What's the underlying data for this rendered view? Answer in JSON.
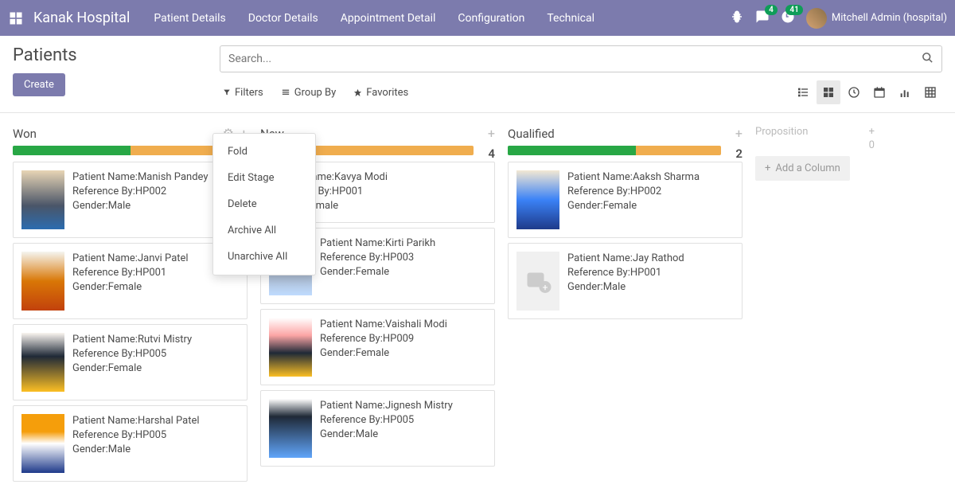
{
  "nav": {
    "brand": "Kanak Hospital",
    "items": [
      "Patient Details",
      "Doctor Details",
      "Appointment Detail",
      "Configuration",
      "Technical"
    ],
    "chat_count": "4",
    "activity_count": "41",
    "user": "Mitchell Admin (hospital)"
  },
  "page": {
    "title": "Patients",
    "create": "Create",
    "search_placeholder": "Search...",
    "filters": "Filters",
    "groupby": "Group By",
    "favorites": "Favorites"
  },
  "popup": {
    "fold": "Fold",
    "edit": "Edit Stage",
    "delete": "Delete",
    "archive": "Archive All",
    "unarchive": "Unarchive All"
  },
  "addcol": {
    "label": "Add a Column",
    "prop": "Proposition",
    "zero": "0"
  },
  "cols": [
    {
      "title": "Won",
      "green": 50,
      "orange": 50,
      "count": "",
      "cards": [
        {
          "name": "Manish Pandey",
          "ref": "HP002",
          "gender": "Male",
          "t": "t1"
        },
        {
          "name": "Janvi Patel",
          "ref": "HP001",
          "gender": "Female",
          "t": "t2"
        },
        {
          "name": "Rutvi Mistry",
          "ref": "HP005",
          "gender": "Female",
          "t": "t3"
        },
        {
          "name": "Harshal Patel",
          "ref": "HP005",
          "gender": "Male",
          "t": "t4"
        }
      ]
    },
    {
      "title": "New",
      "green": 25,
      "orange": 75,
      "count": "4",
      "cards": [
        {
          "name": "Kavya Modi",
          "ref": "HP001",
          "gender": "Female",
          "t": ""
        },
        {
          "name": "Kirti Parikh",
          "ref": "HP003",
          "gender": "Female",
          "t": "t5"
        },
        {
          "name": "Vaishali Modi",
          "ref": "HP009",
          "gender": "Female",
          "t": "t6"
        },
        {
          "name": "Jignesh Mistry",
          "ref": "HP005",
          "gender": "Male",
          "t": "t7"
        }
      ]
    },
    {
      "title": "Qualified",
      "green": 60,
      "orange": 40,
      "count": "2",
      "cards": [
        {
          "name": "Aaksh Sharma",
          "ref": "HP002",
          "gender": "Female",
          "t": "t8"
        },
        {
          "name": "Jay Rathod",
          "ref": "HP001",
          "gender": "Male",
          "t": "ph"
        }
      ]
    }
  ],
  "labels": {
    "pn": "Patient Name:",
    "rb": "Reference By:",
    "g": "Gender:"
  }
}
